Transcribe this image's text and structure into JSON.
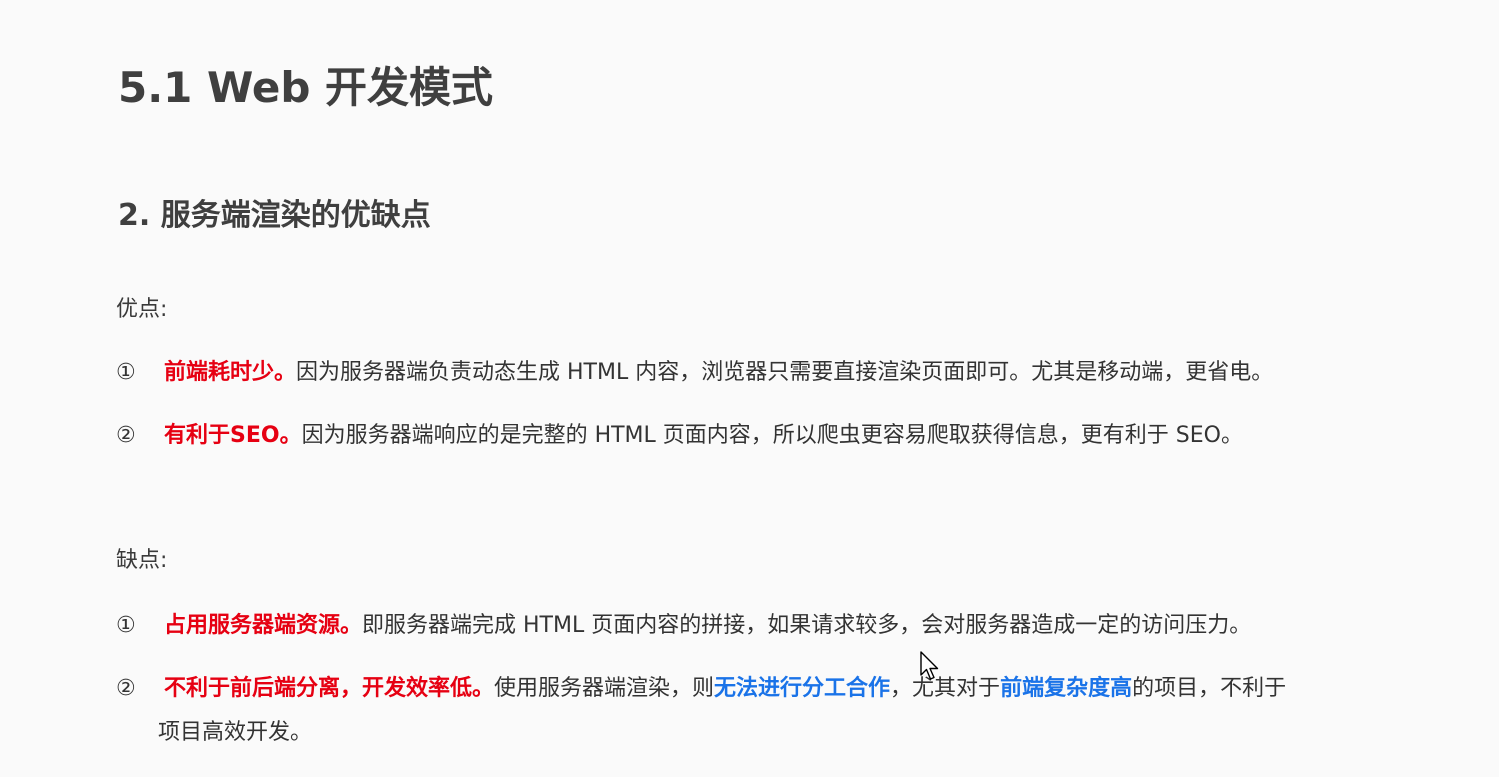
{
  "heading": {
    "title": "5.1 Web 开发模式",
    "subtitle": "2. 服务端渲染的优缺点"
  },
  "pros": {
    "label": "优点:",
    "items": [
      {
        "num": "①",
        "lead": "前端耗时少。",
        "text": "因为服务器端负责动态生成 HTML 内容，浏览器只需要直接渲染页面即可。尤其是移动端，更省电。"
      },
      {
        "num": "②",
        "lead": "有利于SEO。",
        "text": "因为服务器端响应的是完整的 HTML 页面内容，所以爬虫更容易爬取获得信息，更有利于 SEO。"
      }
    ]
  },
  "cons": {
    "label": "缺点:",
    "items": [
      {
        "num": "①",
        "lead": "占用服务器端资源。",
        "text": "即服务器端完成 HTML 页面内容的拼接，如果请求较多，会对服务器造成一定的访问压力。"
      },
      {
        "num": "②",
        "lead": "不利于前后端分离，开发效率低。",
        "text_a": "使用服务器端渲染，则",
        "highlight_a": "无法进行分工合作",
        "text_b": "，尤其对于",
        "highlight_b": "前端复杂度高",
        "text_c": "的项目，不利于",
        "text_cont": "项目高效开发。"
      }
    ]
  },
  "colors": {
    "emphasis_red": "#e60012",
    "emphasis_blue": "#1a73e8",
    "text": "#333333"
  },
  "icons": {
    "cursor": "mouse-pointer-icon"
  }
}
